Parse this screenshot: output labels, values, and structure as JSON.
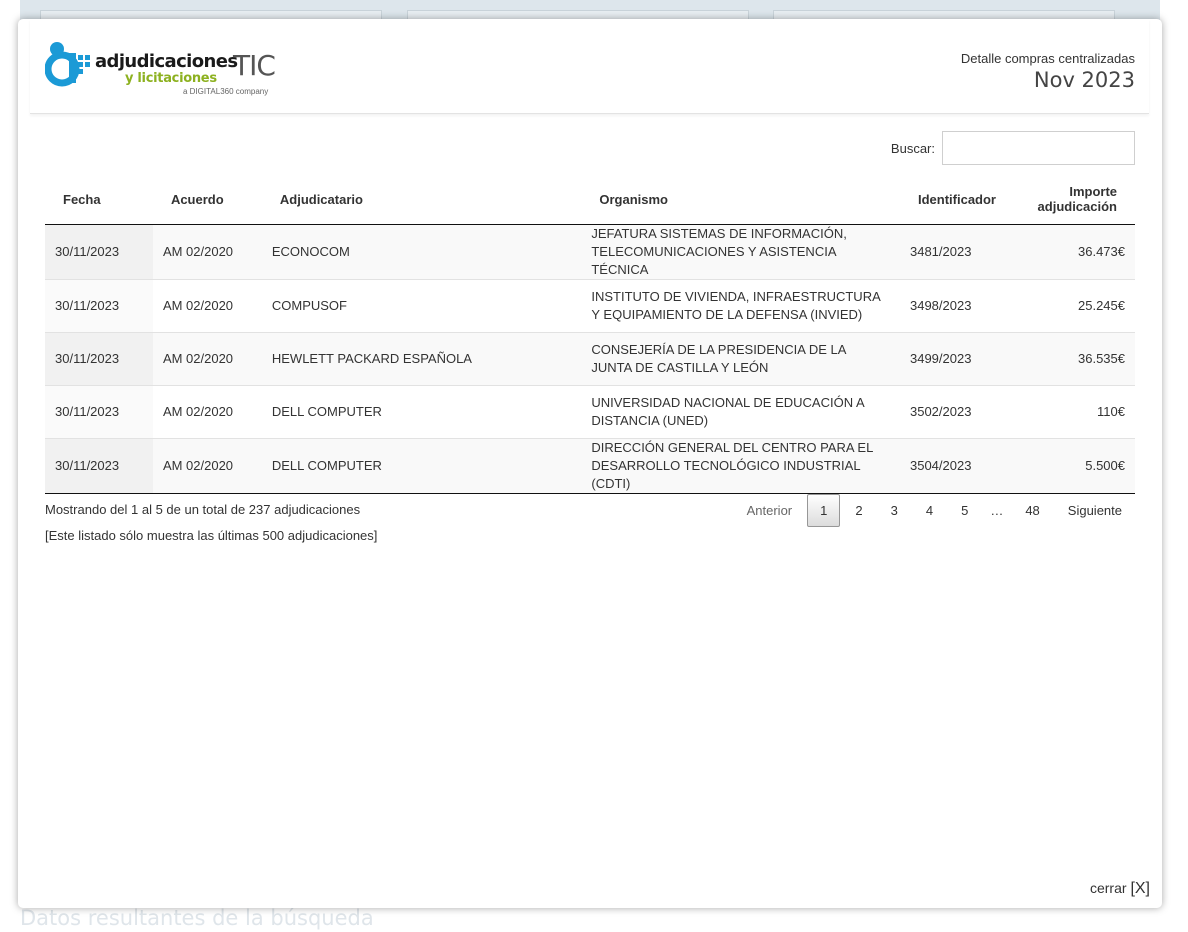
{
  "background": {
    "footer_text": "Datos resultantes de la búsqueda"
  },
  "logo": {
    "main": "adjudicaciones",
    "tic": "TIC",
    "sub": "y licitaciones",
    "company": "a DIGITAL360 company",
    "icon": "adjudicaciones-logo-icon"
  },
  "header": {
    "caption": "Detalle compras centralizadas",
    "month": "Nov 2023"
  },
  "search": {
    "label": "Buscar:",
    "value": ""
  },
  "table": {
    "columns": [
      "Fecha",
      "Acuerdo",
      "Adjudicatario",
      "Organismo",
      "Identificador",
      "Importe adjudicación"
    ],
    "rows": [
      [
        "30/11/2023",
        "AM 02/2020",
        "ECONOCOM",
        "JEFATURA SISTEMAS DE INFORMACIÓN, TELECOMUNICACIONES Y ASISTENCIA TÉCNICA",
        "3481/2023",
        "36.473€"
      ],
      [
        "30/11/2023",
        "AM 02/2020",
        "COMPUSOF",
        "INSTITUTO DE VIVIENDA, INFRAESTRUCTURA Y EQUIPAMIENTO DE LA DEFENSA (INVIED)",
        "3498/2023",
        "25.245€"
      ],
      [
        "30/11/2023",
        "AM 02/2020",
        "HEWLETT PACKARD ESPAÑOLA",
        "CONSEJERÍA DE LA PRESIDENCIA DE LA JUNTA DE CASTILLA Y LEÓN",
        "3499/2023",
        "36.535€"
      ],
      [
        "30/11/2023",
        "AM 02/2020",
        "DELL COMPUTER",
        "UNIVERSIDAD NACIONAL DE EDUCACIÓN A DISTANCIA (UNED)",
        "3502/2023",
        "110€"
      ],
      [
        "30/11/2023",
        "AM 02/2020",
        "DELL COMPUTER",
        "DIRECCIÓN GENERAL DEL CENTRO PARA EL DESARROLLO TECNOLÓGICO INDUSTRIAL (CDTI)",
        "3504/2023",
        "5.500€"
      ]
    ]
  },
  "info": {
    "text": "Mostrando del 1 al 5 de un total de 237 adjudicaciones",
    "note": "[Este listado sólo muestra las últimas 500 adjudicaciones]"
  },
  "pagination": {
    "previous": "Anterior",
    "pages": [
      "1",
      "2",
      "3",
      "4",
      "5"
    ],
    "ellipsis": "…",
    "last": "48",
    "next": "Siguiente",
    "current": "1"
  },
  "close": {
    "label": "cerrar",
    "x": "[X]"
  },
  "colors": {
    "logo_blue": "#1b9ad6",
    "logo_green": "#8db120"
  }
}
